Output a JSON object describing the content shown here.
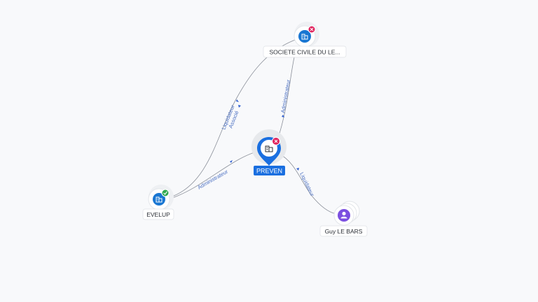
{
  "graph": {
    "nodes": {
      "preven": {
        "label": "PREVEN",
        "type": "company",
        "status": "closed",
        "status_color": "#e0245e"
      },
      "sci": {
        "label": "SOCIETE CIVILE DU LE...",
        "type": "company",
        "status": "closed",
        "status_color": "#e0245e"
      },
      "evelup": {
        "label": "EVELUP",
        "type": "company",
        "status": "active",
        "status_color": "#2fa84f"
      },
      "guy": {
        "label": "Guy LE BARS",
        "type": "person"
      }
    },
    "edges": {
      "evelup_preven": {
        "label": "Administrateur"
      },
      "preven_sci": {
        "label": "Administrateur"
      },
      "evelup_sci_1": {
        "label": "Liquidateur"
      },
      "evelup_sci_2": {
        "label": "Associé"
      },
      "preven_guy": {
        "label": "Liquidateur"
      }
    },
    "icons": {
      "company": "building-icon",
      "person": "person-icon",
      "closed": "close-icon",
      "active": "check-icon"
    },
    "colors": {
      "accent": "#1a6fe0",
      "company": "#1976d2",
      "person": "#7b4fe0",
      "edge": "#8a8f99",
      "edge_label": "#4a6fc2"
    }
  }
}
